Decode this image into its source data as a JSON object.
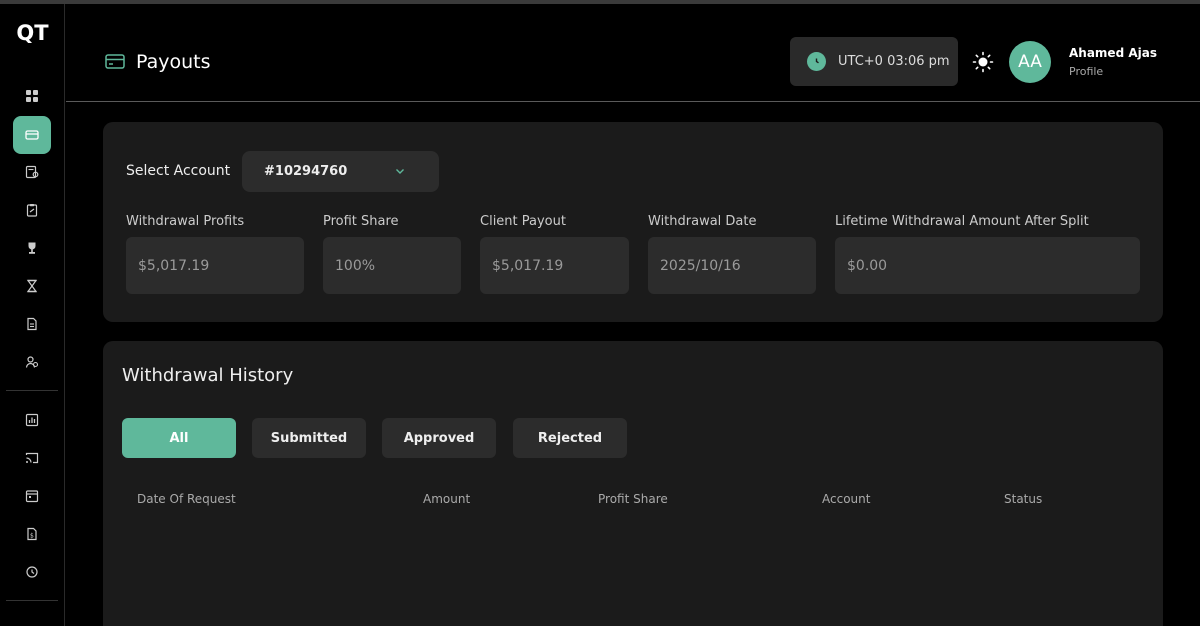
{
  "app": {
    "logo": "QT"
  },
  "header": {
    "title": "Payouts",
    "time": "UTC+0 03:06 pm",
    "avatar_initials": "AA",
    "user_name": "Ahamed Ajas",
    "user_sub": "Profile"
  },
  "sidebar": {
    "items": [
      {
        "name": "dashboard-icon",
        "active": false
      },
      {
        "name": "payouts-icon",
        "active": true
      },
      {
        "name": "certificate-icon",
        "active": false
      },
      {
        "name": "rules-icon",
        "active": false
      },
      {
        "name": "trophy-icon",
        "active": false
      },
      {
        "name": "hourglass-icon",
        "active": false
      },
      {
        "name": "document-icon",
        "active": false
      },
      {
        "name": "users-icon",
        "active": false
      },
      {
        "name": "analytics-icon",
        "active": false
      },
      {
        "name": "cast-icon",
        "active": false
      },
      {
        "name": "calendar-icon",
        "active": false
      },
      {
        "name": "invoice-icon",
        "active": false
      },
      {
        "name": "history-icon",
        "active": false
      }
    ]
  },
  "account": {
    "label": "Select Account",
    "selected": "#10294760"
  },
  "fields": [
    {
      "label": "Withdrawal Profits",
      "value": "$5,017.19"
    },
    {
      "label": "Profit Share",
      "value": "100%"
    },
    {
      "label": "Client Payout",
      "value": "$5,017.19"
    },
    {
      "label": "Withdrawal Date",
      "value": "2025/10/16"
    },
    {
      "label": "Lifetime Withdrawal Amount After Split",
      "value": "$0.00"
    }
  ],
  "history": {
    "title": "Withdrawal History",
    "tabs": [
      "All",
      "Submitted",
      "Approved",
      "Rejected"
    ],
    "columns": [
      "Date Of Request",
      "Amount",
      "Profit Share",
      "Account",
      "Status"
    ]
  },
  "colors": {
    "accent": "#5fb89b",
    "card": "#1b1b1b",
    "field": "#2c2c2c"
  }
}
